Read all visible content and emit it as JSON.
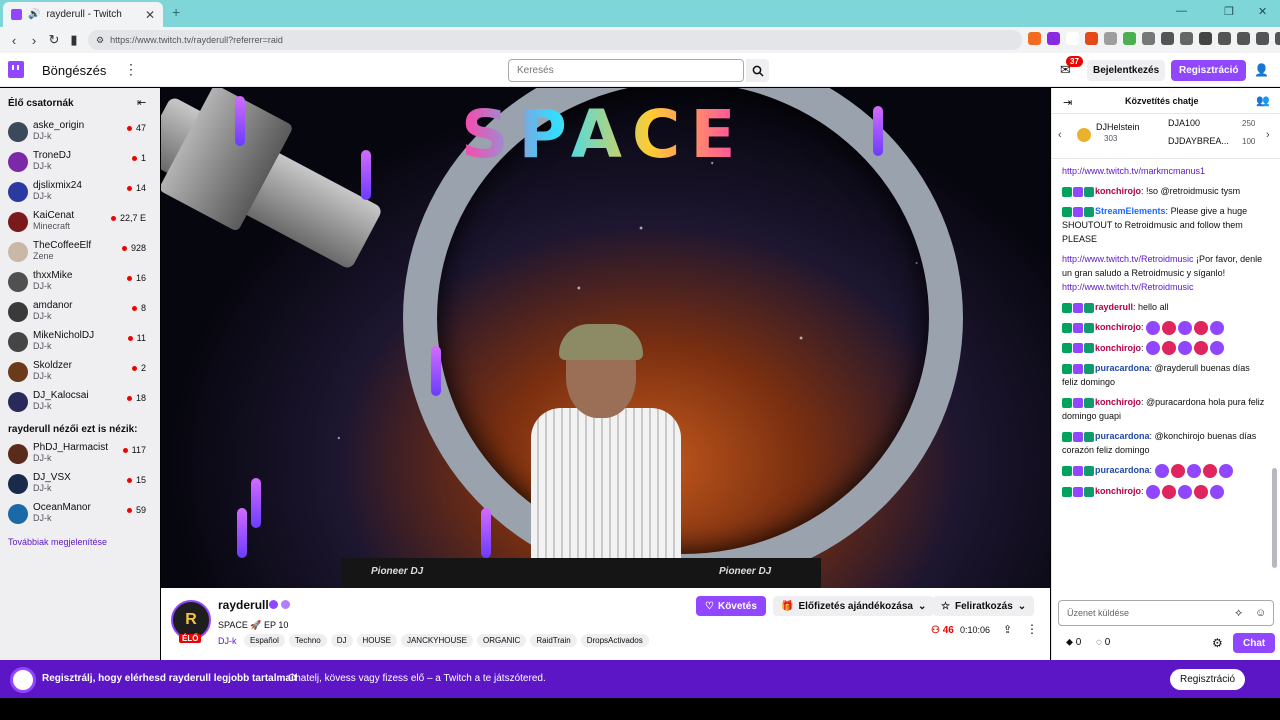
{
  "browser": {
    "tab_title": "rayderull - Twitch",
    "url": "https://www.twitch.tv/rayderull?referrer=raid"
  },
  "topnav": {
    "browse": "Böngészés",
    "search_placeholder": "Keresés",
    "inbox_badge": "37",
    "login": "Bejelentkezés",
    "signup": "Regisztráció"
  },
  "sidebar": {
    "header": "Élő csatornák",
    "channels": [
      {
        "name": "aske_origin",
        "category": "DJ-k",
        "viewers": "47",
        "color": "#3a4a5a"
      },
      {
        "name": "TroneDJ",
        "category": "DJ-k",
        "viewers": "1",
        "color": "#7a2aa8"
      },
      {
        "name": "djslixmix24",
        "category": "DJ-k",
        "viewers": "14",
        "color": "#2a3aa0"
      },
      {
        "name": "KaiCenat",
        "category": "Minecraft",
        "viewers": "22,7 E",
        "color": "#7a1a1a"
      },
      {
        "name": "TheCoffeeElf",
        "category": "Zene",
        "viewers": "928",
        "color": "#c9b8a8"
      },
      {
        "name": "thxxMike",
        "category": "DJ-k",
        "viewers": "16",
        "color": "#505050"
      },
      {
        "name": "amdanor",
        "category": "DJ-k",
        "viewers": "8",
        "color": "#3a3a3a"
      },
      {
        "name": "MikeNicholDJ",
        "category": "DJ-k",
        "viewers": "11",
        "color": "#454545"
      },
      {
        "name": "Skoldzer",
        "category": "DJ-k",
        "viewers": "2",
        "color": "#6a3a1a"
      },
      {
        "name": "DJ_Kalocsai",
        "category": "DJ-k",
        "viewers": "18",
        "color": "#2a2a5a"
      }
    ],
    "also_watching_header": "rayderull nézői ezt is nézik:",
    "also_watching": [
      {
        "name": "PhDJ_Harmacist",
        "category": "DJ-k",
        "viewers": "117",
        "color": "#5a2a1a"
      },
      {
        "name": "DJ_VSX",
        "category": "DJ-k",
        "viewers": "15",
        "color": "#1a2a4a"
      },
      {
        "name": "OceanManor",
        "category": "DJ-k",
        "viewers": "59",
        "color": "#1a6aa8"
      }
    ],
    "show_more": "Továbbiak megjelenítése"
  },
  "video": {
    "overlay_title": "SPACE",
    "mixer_brand": "Pioneer DJ"
  },
  "channel": {
    "avatar_letter": "R",
    "live_badge": "ÉLŐ",
    "name": "rayderull",
    "title": "SPACE 🚀 EP 10",
    "category": "DJ-k",
    "tags": [
      "Español",
      "Techno",
      "DJ",
      "HOUSE",
      "JANCKYHOUSE",
      "ORGANIC",
      "RaidTrain",
      "DropsActivados"
    ],
    "follow": "Követés",
    "gift_sub": "Előfizetés ajándékozása",
    "subscribe": "Feliratkozás",
    "viewers": "46",
    "uptime": "0:10:06"
  },
  "chat": {
    "header": "Közvetítés chatje",
    "leaderboard": {
      "first": {
        "name": "DJHelstein",
        "points": "303"
      },
      "second": {
        "name": "DJA100",
        "points": "250"
      },
      "third": {
        "name": "DJDAYBREA...",
        "points": "100"
      }
    },
    "messages": [
      {
        "user": "",
        "color": "#5c16c5",
        "text": "http://www.twitch.tv/markmcmanus1",
        "is_link": true
      },
      {
        "user": "konchirojo",
        "color": "#b5004a",
        "text": "!so @retroidmusic tysm"
      },
      {
        "user": "StreamElements",
        "color": "#1f69ff",
        "text": "Please give a huge SHOUTOUT to Retroidmusic and follow them PLEASE"
      },
      {
        "user": "",
        "color": "#5c16c5",
        "text": "http://www.twitch.tv/Retroidmusic",
        "is_link": true,
        "after": "¡Por favor, denle un gran saludo a Retroidmusic y síganlo!",
        "link2": "http://www.twitch.tv/Retroidmusic"
      },
      {
        "user": "rayderull",
        "color": "#b5004a",
        "text": "hello all"
      },
      {
        "user": "konchirojo",
        "color": "#b5004a",
        "text": ""
      },
      {
        "user": "konchirojo",
        "color": "#b5004a",
        "text": ""
      },
      {
        "user": "puracardona",
        "color": "#1f4aa8",
        "text": "@rayderull buenas días feliz domingo"
      },
      {
        "user": "konchirojo",
        "color": "#b5004a",
        "text": "@puracardona hola pura feliz domingo guapi"
      },
      {
        "user": "puracardona",
        "color": "#1f4aa8",
        "text": "@konchirojo buenas días corazón feliz domingo"
      },
      {
        "user": "puracardona",
        "color": "#1f4aa8",
        "text": ""
      },
      {
        "user": "konchirojo",
        "color": "#b5004a",
        "text": ""
      }
    ],
    "input_placeholder": "Üzenet küldése",
    "bits": "0",
    "points": "0",
    "send": "Chat"
  },
  "banner": {
    "strong": "Regisztrálj, hogy elérhesd rayderull legjobb tartalmait",
    "text": "Chatelj, kövess vagy fizess elő – a Twitch a te játszótered.",
    "button": "Regisztráció"
  }
}
